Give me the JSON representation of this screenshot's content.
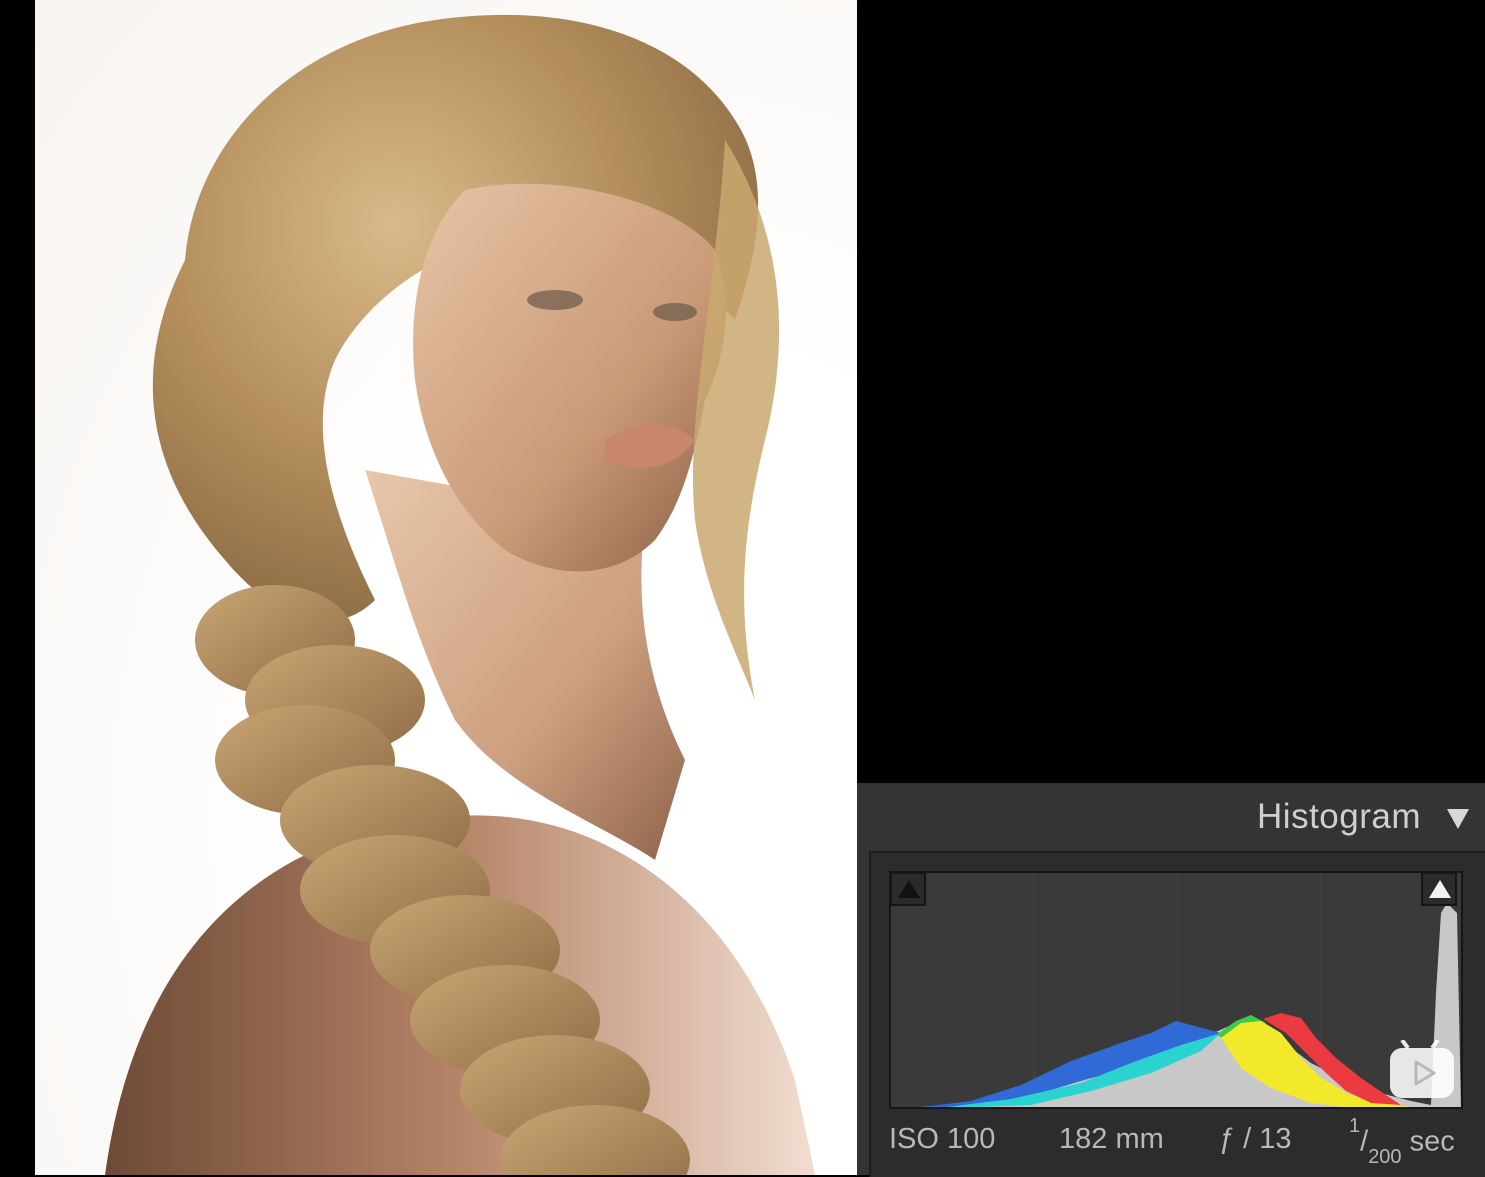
{
  "photo": {
    "subject_icon": "portrait-photo"
  },
  "histogram_panel": {
    "title": "Histogram",
    "collapse_icon": "triangle-down-icon",
    "clip_left_icon": "shadow-clip-triangle-icon",
    "clip_right_icon": "highlight-clip-triangle-icon"
  },
  "exif": {
    "iso": "ISO 100",
    "focal_length": "182 mm",
    "aperture": "ƒ / 13",
    "shutter_num": "1",
    "shutter_den": "200",
    "shutter_unit": "sec"
  },
  "overlay": {
    "play_icon": "play-button-icon"
  },
  "colors": {
    "panel_bg": "#343434",
    "hist_blue": "#2f6ad6",
    "hist_cyan": "#2ad2d0",
    "hist_green": "#3ecb4a",
    "hist_yellow": "#f2e92a",
    "hist_red": "#ec3b40",
    "hist_gray": "#c8c8c8"
  }
}
